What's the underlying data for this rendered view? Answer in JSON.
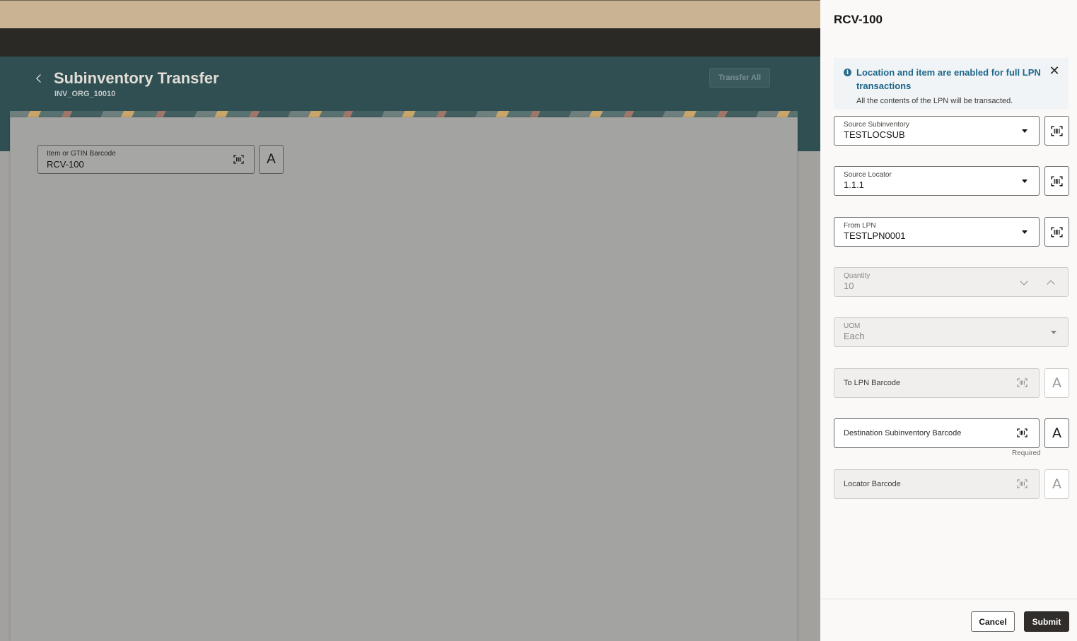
{
  "background": {
    "page_title": "Subinventory Transfer",
    "org_code": "INV_ORG_10010",
    "transfer_all_label": "Transfer All",
    "item_field": {
      "label": "Item or GTIN Barcode",
      "value": "RCV-100"
    },
    "keyboard_glyph": "A"
  },
  "drawer": {
    "title": "RCV-100",
    "banner": {
      "icon_glyph": "i",
      "title": "Location and item are enabled for full LPN transactions",
      "description": "All the contents of the LPN will be transacted.",
      "close_glyph": "✕"
    },
    "fields": {
      "source_subinventory": {
        "label": "Source Subinventory",
        "value": "TESTLOCSUB"
      },
      "source_locator": {
        "label": "Source Locator",
        "value": "1.1.1"
      },
      "from_lpn": {
        "label": "From LPN",
        "value": "TESTLPN0001"
      },
      "quantity": {
        "label": "Quantity",
        "value": "10"
      },
      "uom": {
        "label": "UOM",
        "value": "Each"
      },
      "to_lpn": {
        "label": "To LPN Barcode"
      },
      "destination_subinventory": {
        "label": "Destination Subinventory Barcode",
        "helper": "Required"
      },
      "locator": {
        "label": "Locator Barcode"
      }
    },
    "keyboard_glyph": "A",
    "footer": {
      "cancel_label": "Cancel",
      "submit_label": "Submit"
    }
  },
  "colors": {
    "accent_teal": "#2f4f53",
    "banner_text": "#1f6689",
    "primary_button": "#312d2a"
  },
  "icons": [
    "back-chevron-icon",
    "barcode-scan-icon",
    "keyboard-icon",
    "info-icon",
    "close-icon",
    "dropdown-arrow-icon"
  ]
}
